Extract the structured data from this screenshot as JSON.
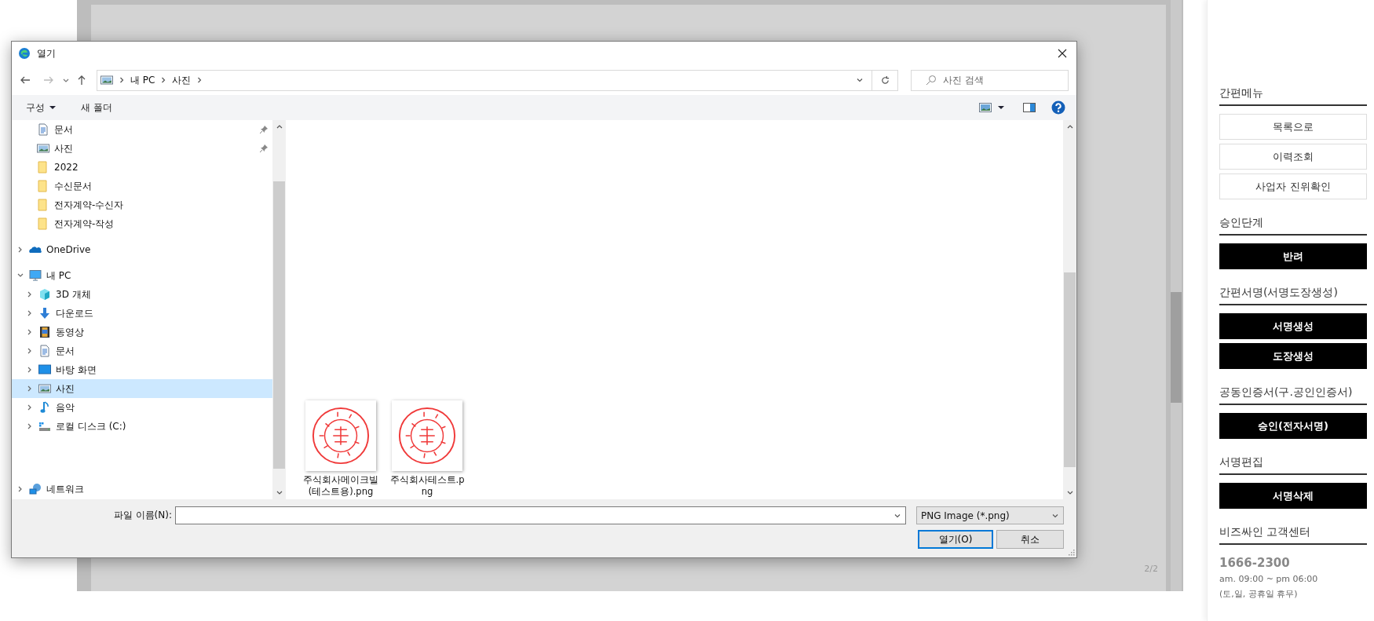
{
  "viewer": {
    "page_indicator": "2/2"
  },
  "dialog": {
    "title": "열기",
    "breadcrumbs": [
      "내 PC",
      "사진"
    ],
    "search": {
      "placeholder": "사진 검색"
    },
    "toolbar": [
      {
        "label": "구성",
        "kind": "menu"
      },
      {
        "label": "새 폴더",
        "kind": "button"
      }
    ],
    "nav": {
      "quick_access": [
        {
          "label": "문서",
          "kind": "document",
          "pinned": true,
          "selected": false
        },
        {
          "label": "사진",
          "kind": "pictures",
          "pinned": true,
          "selected": false
        },
        {
          "label": "2022",
          "kind": "folder",
          "pinned": false,
          "selected": false
        },
        {
          "label": "수신문서",
          "kind": "folder",
          "pinned": false,
          "selected": false
        },
        {
          "label": "전자계약-수신자",
          "kind": "folder",
          "pinned": false,
          "selected": false
        },
        {
          "label": "전자계약-작성",
          "kind": "folder",
          "pinned": false,
          "selected": false
        }
      ],
      "tree": [
        {
          "label": "OneDrive",
          "kind": "cloud",
          "expanded": false,
          "selected": false
        },
        {
          "label": "내 PC",
          "kind": "computer",
          "expanded": true,
          "selected": false,
          "children": [
            {
              "label": "3D 개체",
              "kind": "cube",
              "expanded": false,
              "selected": false
            },
            {
              "label": "다운로드",
              "kind": "download",
              "expanded": false,
              "selected": false
            },
            {
              "label": "동영상",
              "kind": "video",
              "expanded": false,
              "selected": false
            },
            {
              "label": "문서",
              "kind": "document",
              "expanded": false,
              "selected": false
            },
            {
              "label": "바탕 화면",
              "kind": "desktop",
              "expanded": false,
              "selected": false
            },
            {
              "label": "사진",
              "kind": "pictures",
              "expanded": false,
              "selected": true
            },
            {
              "label": "음악",
              "kind": "music",
              "expanded": false,
              "selected": false
            },
            {
              "label": "로컬 디스크 (C:)",
              "kind": "drive",
              "expanded": false,
              "selected": false
            }
          ]
        },
        {
          "label": "네트워크",
          "kind": "network",
          "expanded": false,
          "selected": false
        }
      ]
    },
    "files": [
      {
        "name": "주식회사메이크빌(테스트용).png"
      },
      {
        "name": "주식회사테스트.png"
      }
    ],
    "filename": {
      "label": "파일 이름(N):"
    },
    "file_type": "PNG Image (*.png)",
    "buttons": [
      {
        "label": "열기(O)",
        "default": true
      },
      {
        "label": "취소",
        "default": false
      }
    ]
  },
  "side_panel": {
    "sections": [
      {
        "title": "간편메뉴",
        "buttons": [
          {
            "label": "목록으로",
            "kind": "outline"
          },
          {
            "label": "이력조회",
            "kind": "outline"
          },
          {
            "label": "사업자 진위확인",
            "kind": "outline"
          }
        ]
      },
      {
        "title": "승인단계",
        "buttons": [
          {
            "label": "반려",
            "kind": "dark"
          }
        ]
      },
      {
        "title": "간편서명(서명도장생성)",
        "buttons": [
          {
            "label": "서명생성",
            "kind": "dark"
          },
          {
            "label": "도장생성",
            "kind": "dark"
          }
        ]
      },
      {
        "title": "공동인증서(구.공인인증서)",
        "buttons": [
          {
            "label": "승인(전자서명)",
            "kind": "dark"
          }
        ]
      },
      {
        "title": "서명편집",
        "buttons": [
          {
            "label": "서명삭제",
            "kind": "dark"
          }
        ]
      }
    ],
    "support": {
      "title": "비즈싸인 고객센터",
      "phone": "1666-2300",
      "hours": "am. 09:00 ~ pm 06:00",
      "note": "(토,일, 공휴일 휴무)"
    }
  }
}
